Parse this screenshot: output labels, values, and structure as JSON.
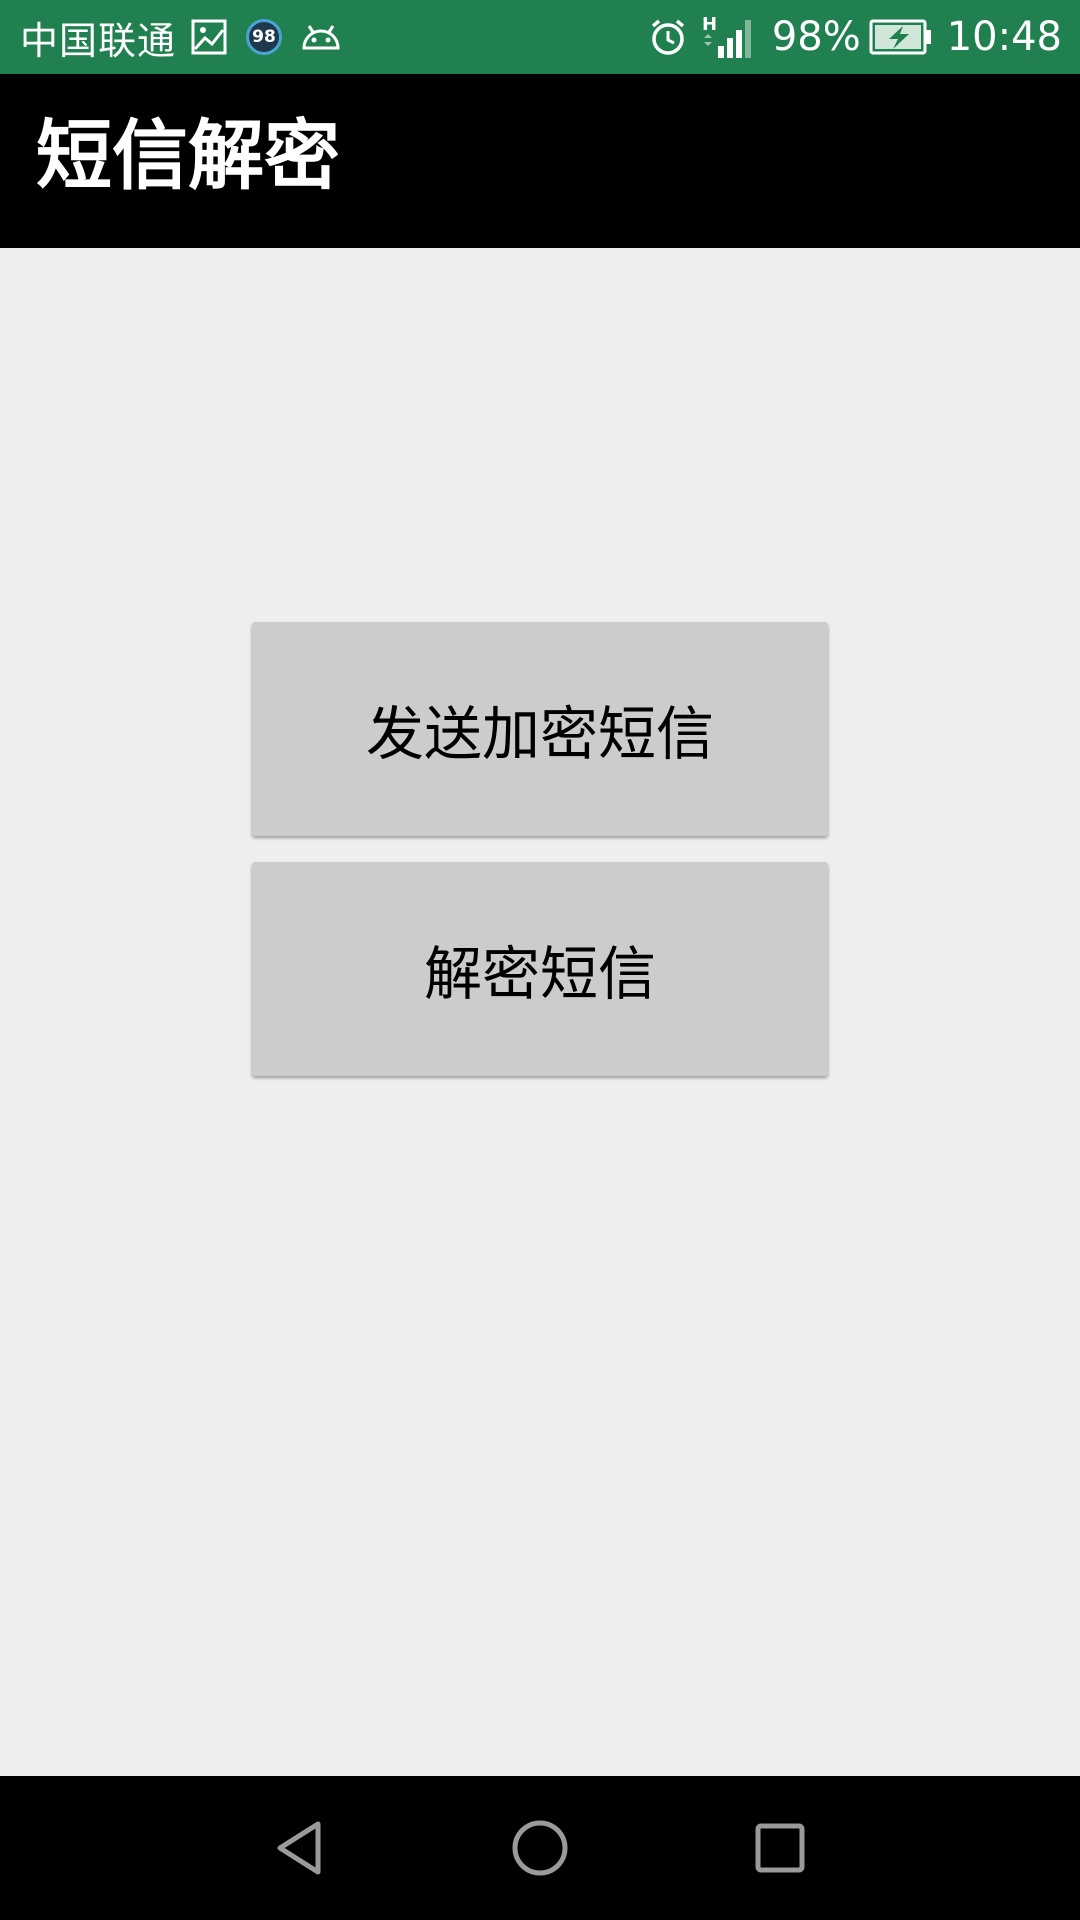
{
  "status_bar": {
    "carrier": "中国联通",
    "notification_badge": "98",
    "network_type": "H",
    "battery_percent": "98%",
    "time": "10:48",
    "icons": [
      "gallery-icon",
      "android-icon",
      "alarm-icon",
      "signal-icon",
      "battery-charging-icon"
    ]
  },
  "app_bar": {
    "title": "短信解密"
  },
  "main": {
    "send_encrypted_label": "发送加密短信",
    "decrypt_label": "解密短信"
  },
  "nav_bar": {
    "icons": [
      "back-icon",
      "home-icon",
      "recents-icon"
    ]
  },
  "colors": {
    "status_bar": "#21804f",
    "app_bar": "#000000",
    "background": "#eeeeee",
    "button": "#cccccc"
  }
}
